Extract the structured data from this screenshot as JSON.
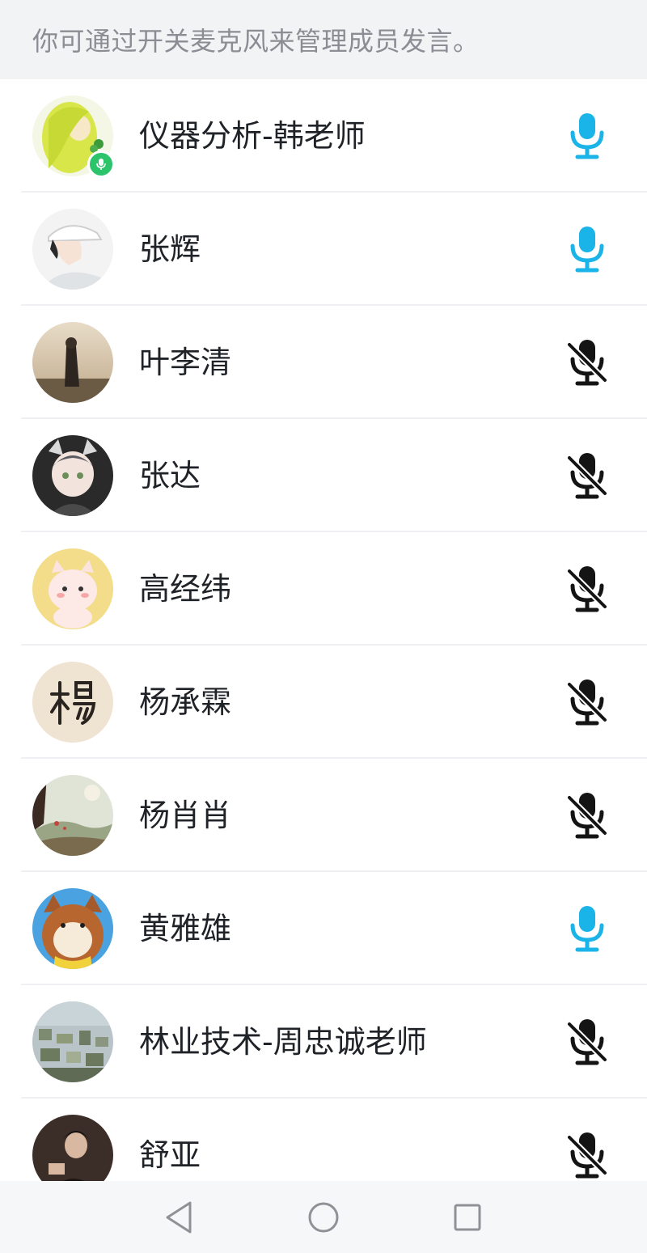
{
  "hint": {
    "text": "你可通过开关麦克风来管理成员发言。"
  },
  "colors": {
    "mic_on": "#1ab4e8",
    "mic_off": "#141414",
    "speaking_badge": "#2bc46b",
    "hint_background": "#f2f3f5"
  },
  "members": [
    {
      "name": "仪器分析-韩老师",
      "mic": "on",
      "mic_icon": "microphone-icon",
      "speaking": true,
      "avatar_icon": "green-haired-girl-avatar"
    },
    {
      "name": "张辉",
      "mic": "on",
      "mic_icon": "microphone-icon",
      "speaking": false,
      "avatar_icon": "boy-cap-avatar"
    },
    {
      "name": "叶李清",
      "mic": "off",
      "mic_icon": "microphone-muted-icon",
      "speaking": false,
      "avatar_icon": "person-beach-avatar"
    },
    {
      "name": "张达",
      "mic": "off",
      "mic_icon": "microphone-muted-icon",
      "speaking": false,
      "avatar_icon": "anime-cat-girl-avatar"
    },
    {
      "name": "高经纬",
      "mic": "off",
      "mic_icon": "microphone-muted-icon",
      "speaking": false,
      "avatar_icon": "cartoon-cat-avatar"
    },
    {
      "name": "杨承霖",
      "mic": "off",
      "mic_icon": "microphone-muted-icon",
      "speaking": false,
      "avatar_icon": "calligraphy-yang-avatar"
    },
    {
      "name": "杨肖肖",
      "mic": "off",
      "mic_icon": "microphone-muted-icon",
      "speaking": false,
      "avatar_icon": "landscape-painting-avatar"
    },
    {
      "name": "黄雅雄",
      "mic": "on",
      "mic_icon": "microphone-icon",
      "speaking": false,
      "avatar_icon": "shiba-dog-avatar"
    },
    {
      "name": "林业技术-周忠诚老师",
      "mic": "off",
      "mic_icon": "microphone-muted-icon",
      "speaking": false,
      "avatar_icon": "city-aerial-avatar"
    },
    {
      "name": "舒亚",
      "mic": "off",
      "mic_icon": "microphone-muted-icon",
      "speaking": false,
      "avatar_icon": "man-portrait-avatar"
    }
  ],
  "nav": {
    "back_icon": "back-triangle-icon",
    "home_icon": "home-circle-icon",
    "recents_icon": "recents-square-icon"
  }
}
